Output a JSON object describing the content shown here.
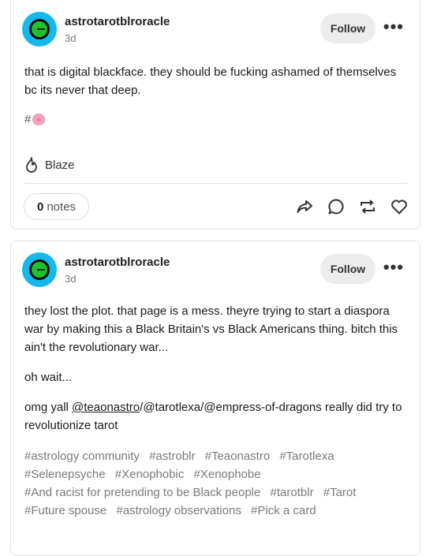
{
  "posts": [
    {
      "username": "astrotarotblroracle",
      "time": "3d",
      "follow_label": "Follow",
      "more_label": "•••",
      "paragraphs": [
        "that is digital blackface. they should be fucking ashamed of themselves bc its never that deep."
      ],
      "hashtag_prefix": "#",
      "hashtag_icon": "pig-face-emoji",
      "blaze_label": "Blaze",
      "notes_count": "0",
      "notes_label": "notes"
    },
    {
      "username": "astrotarotblroracle",
      "time": "3d",
      "follow_label": "Follow",
      "more_label": "•••",
      "paragraphs": [
        "they lost the plot. that page is a mess. theyre trying to start a diaspora war by making this a Black Britain's vs Black Americans thing. bitch this ain't the revolutionary war...",
        "oh wait...",
        "omg yall ",
        "/@tarotlexa/@empress-of-dragons really did try to revolutionize tarot"
      ],
      "mention": "@teaonastro",
      "tags": [
        "#astrology community",
        "#astroblr",
        "#Teaonastro",
        "#Tarotlexa",
        "#Selenepsyche",
        "#Xenophobic",
        "#Xenophobe",
        "#And racist for pretending to be Black people",
        "#tarotblr",
        "#Tarot",
        "#Future spouse",
        "#astrology observations",
        "#Pick a card"
      ]
    }
  ],
  "colors": {
    "avatar_bg": "#16b7ea",
    "avatar_face": "#1fc22c",
    "follow_bg": "#ececec",
    "tag_text": "#7a7a7a"
  }
}
